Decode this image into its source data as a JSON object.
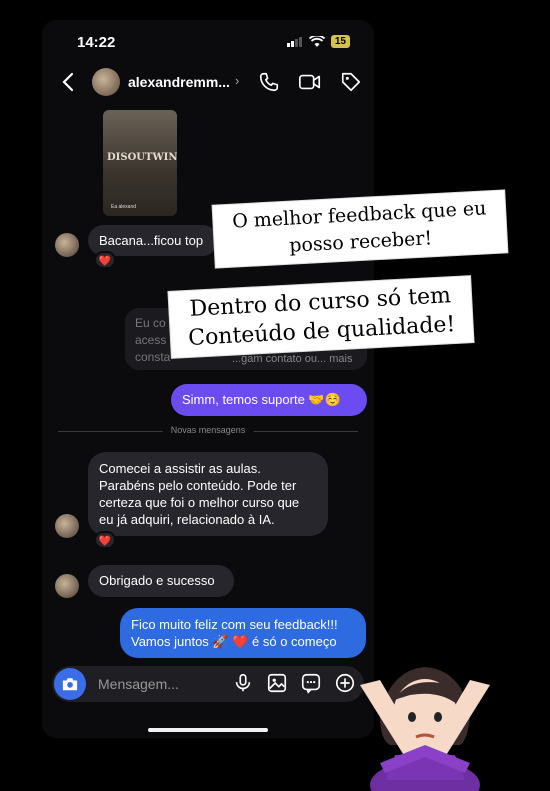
{
  "status_bar": {
    "time": "14:22",
    "battery": "15"
  },
  "header": {
    "contact_name": "alexandremm...",
    "chevron": "›"
  },
  "book": {
    "title": "DISOUTWINS",
    "author": "Ea alexand"
  },
  "messages": {
    "m1": "Bacana...ficou top",
    "faded_text": "Eu co\nacess\nconsta",
    "faded_more": "...gam contato ou... mais",
    "m2": "Simm, temos suporte 🤝☺️",
    "divider": "Novas mensagens",
    "m3": "Comecei a assistir as aulas. Parabéns pelo conteúdo. Pode ter certeza que foi o melhor curso que eu já adquiri, relacionado à IA.",
    "m4": "Obrigado e sucesso",
    "m5": "Fico muito feliz com seu feedback!!! Vamos juntos 🚀 ❤️ é só o começo",
    "reaction": "❤️"
  },
  "composer": {
    "placeholder": "Mensagem..."
  },
  "overlays": {
    "note1": "O melhor feedback que eu posso receber!",
    "note2": "Dentro do curso só tem Conteúdo de qualidade!"
  },
  "icons": [
    "back-icon",
    "phone-icon",
    "video-icon",
    "tag-icon",
    "camera-icon",
    "mic-icon",
    "gallery-icon",
    "sticker-icon",
    "plus-icon"
  ],
  "colors": {
    "accent_purple": "#6a4cf0",
    "accent_blue": "#2e6ae0",
    "bubble_in": "#26262c"
  }
}
